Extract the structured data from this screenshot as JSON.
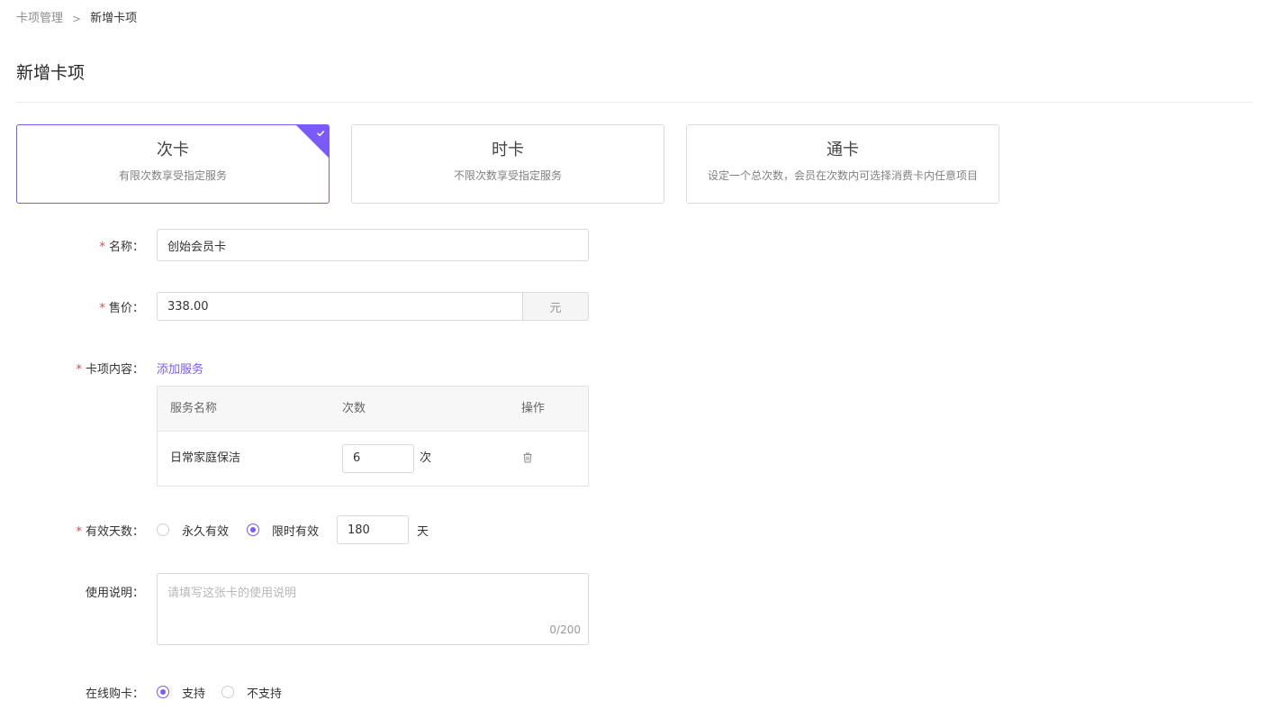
{
  "breadcrumb": {
    "parent": "卡项管理",
    "separator": ">",
    "current": "新增卡项"
  },
  "page": {
    "title": "新增卡项"
  },
  "card_types": [
    {
      "title": "次卡",
      "desc": "有限次数享受指定服务",
      "selected": true
    },
    {
      "title": "时卡",
      "desc": "不限次数享受指定服务",
      "selected": false
    },
    {
      "title": "通卡",
      "desc": "设定一个总次数，会员在次数内可选择消费卡内任意项目",
      "selected": false
    }
  ],
  "form": {
    "required_mark": "*",
    "name": {
      "label": "名称：",
      "value": "创始会员卡"
    },
    "price": {
      "label": "售价：",
      "value": "338.00",
      "unit": "元"
    },
    "content": {
      "label": "卡项内容：",
      "add_link": "添加服务",
      "columns": [
        "服务名称",
        "次数",
        "操作"
      ],
      "rows": [
        {
          "name": "日常家庭保洁",
          "count": "6",
          "unit": "次"
        }
      ]
    },
    "validity": {
      "label": "有效天数：",
      "option_forever": "永久有效",
      "option_limited": "限时有效",
      "days": "180",
      "unit": "天",
      "selected": "limited"
    },
    "description": {
      "label": "使用说明：",
      "placeholder": "请填写这张卡的使用说明",
      "counter": "0/200"
    },
    "online": {
      "label": "在线购卡：",
      "option_yes": "支持",
      "option_no": "不支持",
      "selected": "yes"
    }
  },
  "colors": {
    "accent": "#7a5af8",
    "required": "#e64340"
  }
}
